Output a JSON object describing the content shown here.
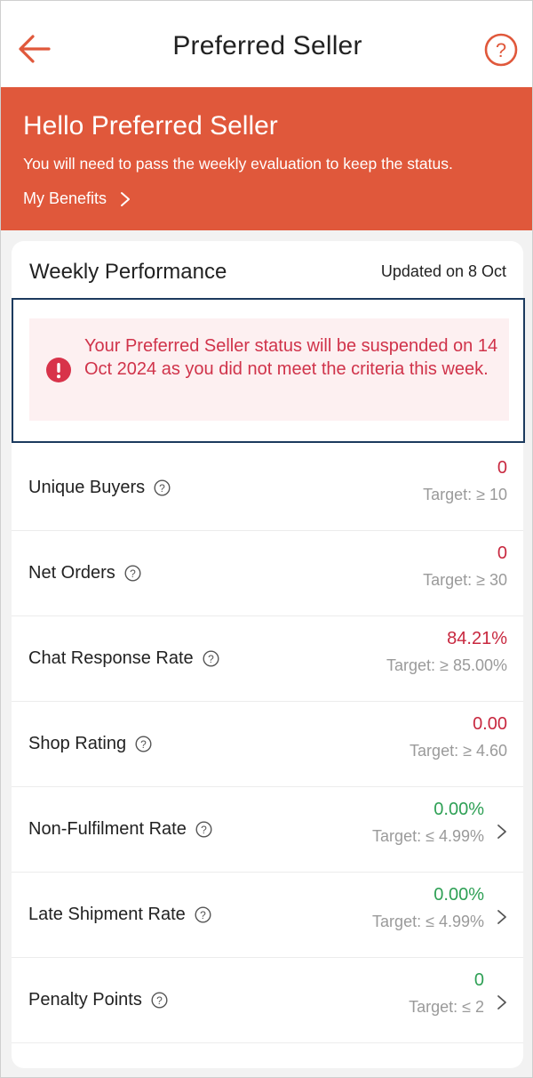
{
  "header": {
    "title": "Preferred Seller",
    "back_icon": "arrow-left-icon",
    "help_icon": "question-circle-icon"
  },
  "hero": {
    "title": "Hello Preferred Seller",
    "subtitle": "You will need to pass the weekly evaluation to keep the status.",
    "benefits_label": "My Benefits"
  },
  "performance": {
    "title": "Weekly Performance",
    "updated": "Updated on 8 Oct",
    "alert": "Your Preferred Seller status will be suspended on 14 Oct 2024 as you did not meet the criteria this week."
  },
  "metrics": [
    {
      "label": "Unique Buyers",
      "value": "0",
      "target": "Target: ≥ 10",
      "status": "fail",
      "has_chevron": false
    },
    {
      "label": "Net Orders",
      "value": "0",
      "target": "Target: ≥ 30",
      "status": "fail",
      "has_chevron": false
    },
    {
      "label": "Chat Response Rate",
      "value": "84.21%",
      "target": "Target: ≥ 85.00%",
      "status": "fail",
      "has_chevron": false
    },
    {
      "label": "Shop Rating",
      "value": "0.00",
      "target": "Target: ≥ 4.60",
      "status": "fail",
      "has_chevron": false
    },
    {
      "label": "Non-Fulfilment Rate",
      "value": "0.00%",
      "target": "Target: ≤ 4.99%",
      "status": "pass",
      "has_chevron": true
    },
    {
      "label": "Late Shipment Rate",
      "value": "0.00%",
      "target": "Target: ≤ 4.99%",
      "status": "pass",
      "has_chevron": true
    },
    {
      "label": "Penalty Points",
      "value": "0",
      "target": "Target: ≤ 2",
      "status": "pass",
      "has_chevron": true
    }
  ],
  "colors": {
    "brand": "#e0583b",
    "fail": "#c8283f",
    "pass": "#2ea055",
    "alert_bg": "#fdf0f1"
  }
}
